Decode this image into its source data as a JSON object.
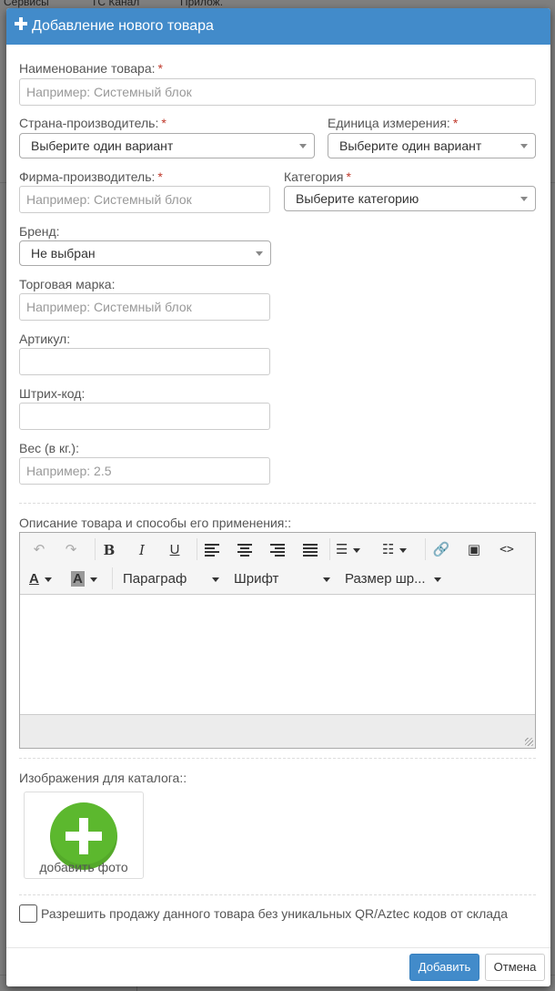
{
  "background": {
    "top_items": [
      "Сервисы",
      "ТС Канал",
      "Прилож."
    ]
  },
  "modal": {
    "title": "Добавление нового товара",
    "fields": {
      "name": {
        "label": "Наименование товара:",
        "required": "*",
        "placeholder": "Например: Системный блок"
      },
      "country": {
        "label": "Страна-производитель:",
        "required": "*",
        "value": "Выберите один вариант"
      },
      "unit": {
        "label": "Единица измерения:",
        "required": "*",
        "value": "Выберите один вариант"
      },
      "manufacturer": {
        "label": "Фирма-производитель:",
        "required": "*",
        "placeholder": "Например: Системный блок"
      },
      "category": {
        "label": "Категория",
        "required": "*",
        "value": "Выберите категорию"
      },
      "brand": {
        "label": "Бренд:",
        "value": "Не выбран"
      },
      "trademark": {
        "label": "Торговая марка:",
        "placeholder": "Например: Системный блок"
      },
      "article": {
        "label": "Артикул:",
        "value": ""
      },
      "barcode": {
        "label": "Штрих-код:",
        "value": ""
      },
      "weight": {
        "label": "Вес (в кг.):",
        "placeholder": "Например: 2.5"
      }
    },
    "description": {
      "label": "Описание товара и способы его применения::",
      "toolbar": {
        "paragraph": "Параграф",
        "font": "Шрифт",
        "font_size": "Размер шр..."
      }
    },
    "images": {
      "label": "Изображения для каталога::",
      "add_photo": "добавить фото"
    },
    "allow_sale": {
      "label": "Разрешить продажу данного товара без уникальных QR/Aztec кодов от склада",
      "checked": false
    },
    "buttons": {
      "add": "Добавить",
      "cancel": "Отмена"
    }
  },
  "colors": {
    "header": "#428bca",
    "required": "#c0392b",
    "add_photo": "#5cb82e"
  }
}
